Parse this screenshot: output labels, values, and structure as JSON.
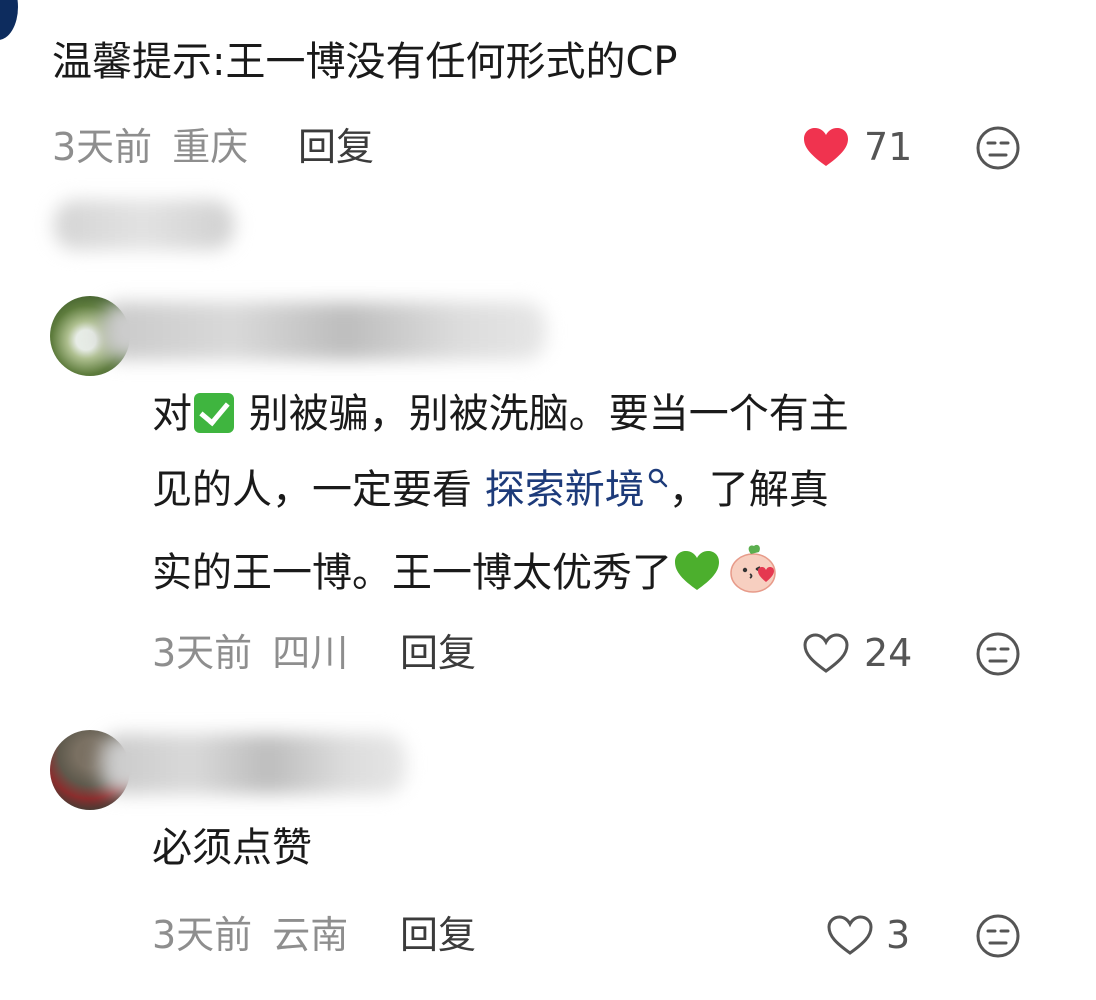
{
  "comments": [
    {
      "text": "温馨提示:王一博没有任何形式的CP",
      "time": "3天前",
      "location": "重庆",
      "reply_label": "回复",
      "likes": "71",
      "liked": true
    },
    {
      "text_parts": {
        "p1": "对",
        "p2": "别被骗，别被洗脑。要当一个有主",
        "p3": "见的人，一定要看 ",
        "link": "探索新境",
        "p4": "，了解真",
        "p5": "实的王一博。王一博太优秀了"
      },
      "time": "3天前",
      "location": "四川",
      "reply_label": "回复",
      "likes": "24",
      "liked": false
    },
    {
      "text": "必须点赞",
      "time": "3天前",
      "location": "云南",
      "reply_label": "回复",
      "likes": "3",
      "liked": false
    }
  ],
  "colors": {
    "liked_heart": "#f0334f",
    "link": "#1d3b7a",
    "meta_text": "#8e8e8e"
  },
  "icons": [
    "heart-filled-icon",
    "heart-outline-icon",
    "neutral-face-icon",
    "check-emoji-icon",
    "green-heart-emoji",
    "peach-kiss-emoji",
    "search-link-icon"
  ]
}
